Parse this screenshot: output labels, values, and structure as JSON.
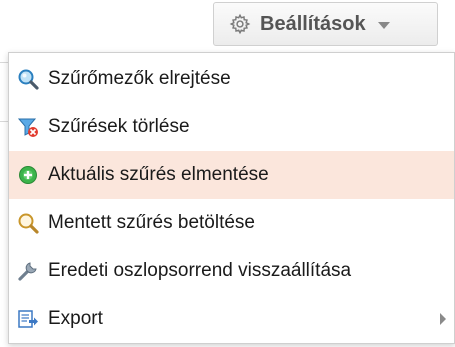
{
  "settings_button": {
    "label": "Beállítások",
    "icon": "gear-icon",
    "caret_icon": "caret-down-icon"
  },
  "menu": {
    "items": [
      {
        "label": "Szűrőmezők elrejtése",
        "icon": "search-icon"
      },
      {
        "label": "Szűrések törlése",
        "icon": "filter-clear-icon"
      },
      {
        "label": "Aktuális szűrés elmentése",
        "icon": "add-circle-icon",
        "highlighted": true
      },
      {
        "label": "Mentett szűrés betöltése",
        "icon": "magnifier-icon"
      },
      {
        "label": "Eredeti oszlopsorrend visszaállítása",
        "icon": "wrench-icon"
      },
      {
        "label": "Export",
        "icon": "export-icon",
        "has_submenu": true
      }
    ]
  },
  "colors": {
    "highlight": "#fbe6dc",
    "add_icon": "#3cb44b",
    "filter_icon": "#2f8fd8",
    "filter_clear": "#e23b2e",
    "menu_border": "#cfcfcf"
  }
}
